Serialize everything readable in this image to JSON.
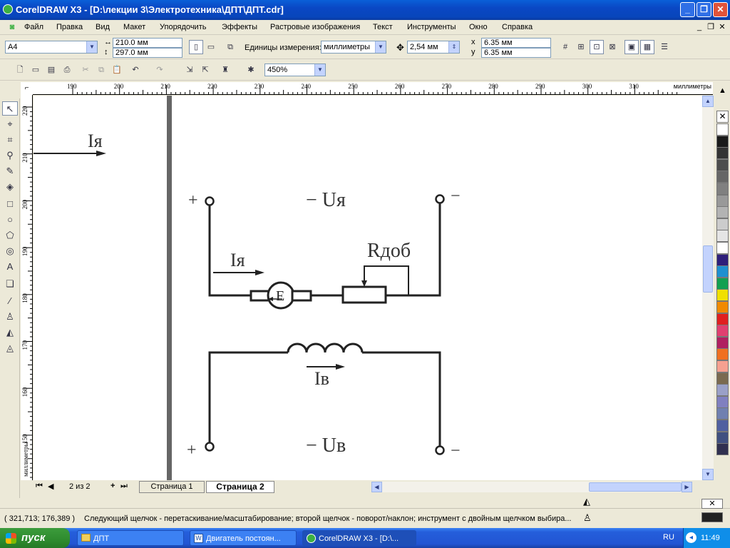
{
  "window": {
    "title": "CorelDRAW X3 - [D:\\лекции 3\\Электротехника\\ДПТ\\ДПТ.cdr]"
  },
  "menu": [
    "Файл",
    "Правка",
    "Вид",
    "Макет",
    "Упорядочить",
    "Эффекты",
    "Растровые изображения",
    "Текст",
    "Инструменты",
    "Окно",
    "Справка"
  ],
  "property_bar": {
    "paper_size": "A4",
    "width": "210.0 мм",
    "height": "297.0 мм",
    "units_label": "Единицы измерения:",
    "units_value": "миллиметры",
    "nudge": "2,54 мм",
    "dup_x": "6.35 мм",
    "dup_y": "6.35 мм"
  },
  "standard_bar": {
    "zoom": "450%"
  },
  "rulers": {
    "unit": "миллиметры",
    "h_ticks": [
      "190",
      "200",
      "210",
      "220",
      "230",
      "240",
      "250",
      "260",
      "270",
      "280",
      "290",
      "300",
      "310"
    ],
    "v_ticks": [
      "220",
      "210",
      "200",
      "190",
      "180",
      "170",
      "160",
      "150"
    ]
  },
  "canvas": {
    "left_label": "Iя",
    "terminals": {
      "plus": "+",
      "minus": "−"
    },
    "armature_voltage": "− Uя",
    "armature_current": "Iя",
    "motor_symbol": "E",
    "resistor_label": "Rдоб",
    "field_current": "Iв",
    "field_voltage": "− Uв"
  },
  "pages": {
    "counter": "2 из 2",
    "tabs": [
      "Страница 1",
      "Страница 2"
    ],
    "active": "Страница 2"
  },
  "status": {
    "coords": "( 321,713; 176,389 )",
    "hint": "Следующий щелчок - перетаскивание/масштабирование; второй щелчок - поворот/наклон; инструмент с двойным щелчком выбира..."
  },
  "palette_colors": [
    "#ffffff",
    "#1a1a1a",
    "#333333",
    "#4d4d4d",
    "#666666",
    "#808080",
    "#999999",
    "#b3b3b3",
    "#cccccc",
    "#e5e5e5",
    "#ffffff",
    "#2e1f7a",
    "#1e90d0",
    "#12a050",
    "#f0e000",
    "#f08a00",
    "#e02020",
    "#e04070",
    "#b02060",
    "#f07020",
    "#f5a090",
    "#7a6a50",
    "#9aa0c8",
    "#8080c0",
    "#7080b0",
    "#5060a0",
    "#405080",
    "#303050"
  ],
  "taskbar": {
    "start": "пуск",
    "items": [
      "ДПТ",
      "Двигатель постоян...",
      "CorelDRAW X3 - [D:\\..."
    ],
    "lang": "RU",
    "clock": "11:49"
  }
}
